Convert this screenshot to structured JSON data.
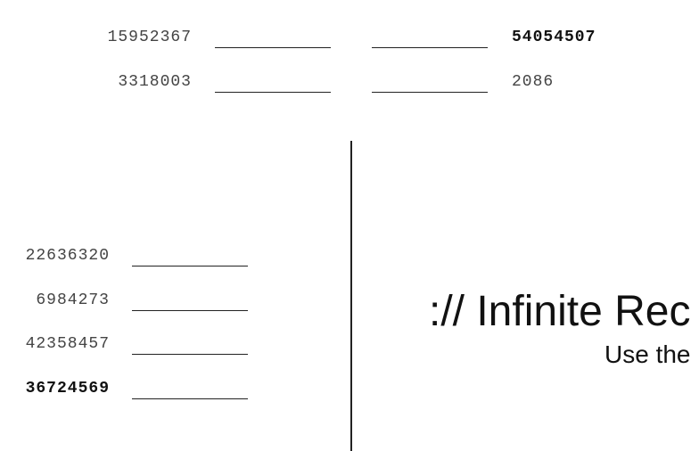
{
  "top_rows": [
    {
      "left": "15952367",
      "right": "54054507"
    },
    {
      "left": "3318003",
      "right": "2086"
    }
  ],
  "left_list": [
    "22636320",
    "6984273",
    "42358457",
    "36724569"
  ],
  "message": {
    "headline": ":// Infinite Rec",
    "subline": "Use the"
  }
}
